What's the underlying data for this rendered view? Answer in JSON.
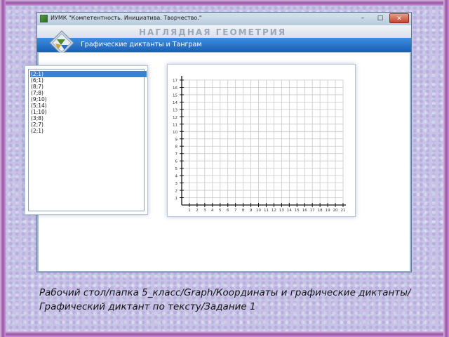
{
  "window": {
    "title": "ИУМК \"Компетентность. Инициатива. Творчество.\"",
    "controls": {
      "minimize": "–",
      "maximize": "□",
      "close": "✕"
    },
    "header_title": "НАГЛЯДНАЯ ГЕОМЕТРИЯ",
    "section_title": "Графические диктанты и Танграм"
  },
  "coordinates_list": {
    "items": [
      "(2;1)",
      "(6;1)",
      "(8;7)",
      "(7;8)",
      "(9;10)",
      "(5;14)",
      "(1;10)",
      "(3;8)",
      "(2;7)",
      "(2;1)"
    ],
    "selected_index": 0
  },
  "graph": {
    "y_ticks": [
      "17",
      "16",
      "15",
      "14",
      "13",
      "12",
      "11",
      "10",
      "9",
      "8",
      "7",
      "6",
      "5",
      "4",
      "3",
      "2",
      "1"
    ],
    "x_ticks": [
      "1",
      "2",
      "3",
      "4",
      "5",
      "6",
      "7",
      "8",
      "9",
      "10",
      "11",
      "12",
      "13",
      "14",
      "15",
      "16",
      "17",
      "18",
      "19",
      "20",
      "21"
    ]
  },
  "caption": "Рабочий стол/папка 5_класс/Graph/Координаты и графические диктанты/Графический диктант по тексту/Задание 1",
  "colors": {
    "accent": "#1a5fb5",
    "frame": "#9a55a8"
  }
}
